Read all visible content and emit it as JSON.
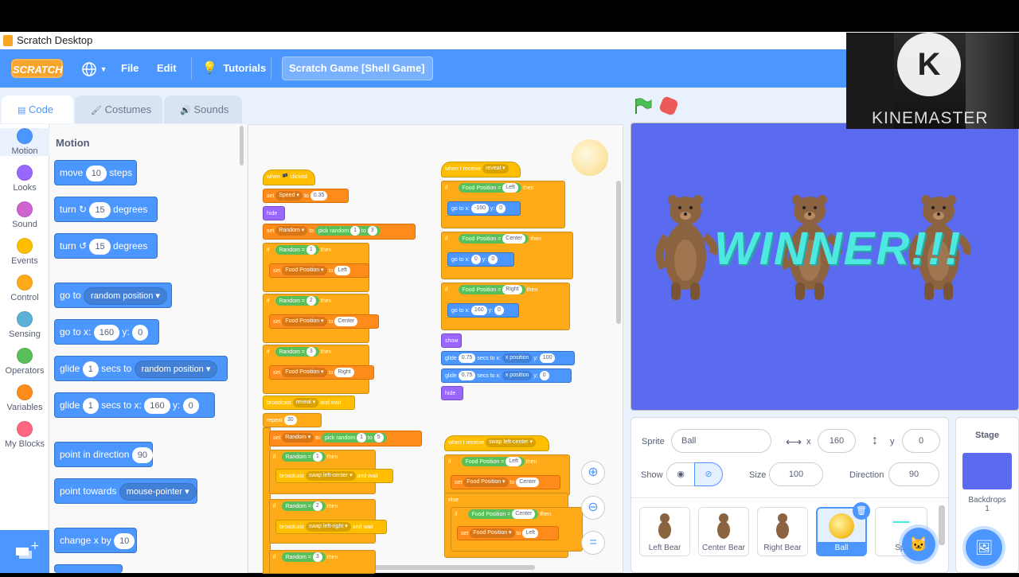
{
  "window": {
    "title": "Scratch Desktop"
  },
  "menubar": {
    "logo": "SCRATCH",
    "file": "File",
    "edit": "Edit",
    "tutorials": "Tutorials",
    "project_title": "Scratch Game [Shell Game]"
  },
  "tabs": [
    {
      "label": "Code"
    },
    {
      "label": "Costumes"
    },
    {
      "label": "Sounds"
    }
  ],
  "categories": [
    {
      "label": "Motion",
      "color": "#4c97ff"
    },
    {
      "label": "Looks",
      "color": "#9966ff"
    },
    {
      "label": "Sound",
      "color": "#cf63cf"
    },
    {
      "label": "Events",
      "color": "#ffbf00"
    },
    {
      "label": "Control",
      "color": "#ffab19"
    },
    {
      "label": "Sensing",
      "color": "#5cb1d6"
    },
    {
      "label": "Operators",
      "color": "#59c059"
    },
    {
      "label": "Variables",
      "color": "#ff8c1a"
    },
    {
      "label": "My Blocks",
      "color": "#ff6680"
    }
  ],
  "palette": {
    "heading": "Motion",
    "move": {
      "pre": "move",
      "val": "10",
      "post": "steps"
    },
    "turn_right": {
      "pre": "turn",
      "val": "15",
      "post": "degrees"
    },
    "turn_left": {
      "pre": "turn",
      "val": "15",
      "post": "degrees"
    },
    "goto": {
      "pre": "go to",
      "drop": "random position"
    },
    "gotoxy": {
      "pre": "go to x:",
      "x": "160",
      "ylbl": "y:",
      "y": "0"
    },
    "glide": {
      "pre": "glide",
      "val": "1",
      "mid": "secs to",
      "drop": "random position"
    },
    "glidexy": {
      "pre": "glide",
      "val": "1",
      "mid": "secs to x:",
      "x": "160",
      "ylbl": "y:",
      "y": "0"
    },
    "point_dir": {
      "pre": "point in direction",
      "val": "90"
    },
    "point_towards": {
      "pre": "point towards",
      "drop": "mouse-pointer"
    },
    "changex": {
      "pre": "change x by",
      "val": "10"
    }
  },
  "script1": {
    "when_clicked": "when 🏴 clicked",
    "set": "set",
    "speed": "Speed",
    "to": "to",
    "speed_val": "0.35",
    "hide": "hide",
    "random": "Random",
    "pick_random": "pick random",
    "r1": "1",
    "r2": "3",
    "if": "if",
    "then": "then",
    "eq": "=",
    "one": "1",
    "two": "2",
    "three": "3",
    "food_position": "Food Position",
    "left": "Left",
    "center": "Center",
    "right": "Right",
    "broadcast": "broadcast",
    "reveal": "reveal",
    "and_wait": "and wait",
    "repeat": "repeat",
    "repeat_val": "30",
    "pick2": "5",
    "swap_left_center": "swap left-center",
    "swap_left_right": "swap left-right"
  },
  "script2": {
    "when_receive": "when I receive",
    "reveal": "reveal",
    "goto_x": "go to x:",
    "y": "y:",
    "xl": "-160",
    "xc": "0",
    "xr": "160",
    "y0": "0",
    "show": "show",
    "glide": "glide",
    "gv": "0.75",
    "secs_to_x": "secs to x:",
    "x_position": "x position",
    "y100": "100",
    "y0b": "0"
  },
  "script3": {
    "when_receive": "when I receive",
    "msg": "swap left-center",
    "else": "else"
  },
  "stage": {
    "banner": "WINNER!!!"
  },
  "sprite_info": {
    "sprite_label": "Sprite",
    "sprite_name": "Ball",
    "x_label": "x",
    "x": "160",
    "y_label": "y",
    "y": "0",
    "show_label": "Show",
    "size_label": "Size",
    "size": "100",
    "direction_label": "Direction",
    "direction": "90"
  },
  "sprites": [
    {
      "name": "Left Bear"
    },
    {
      "name": "Center Bear"
    },
    {
      "name": "Right Bear"
    },
    {
      "name": "Ball"
    },
    {
      "name": "Spr"
    }
  ],
  "stage_panel": {
    "title": "Stage",
    "backdrops_label": "Backdrops",
    "backdrops_count": "1"
  },
  "webcam": {
    "watermark": "KINEMASTER",
    "logo": "K"
  }
}
